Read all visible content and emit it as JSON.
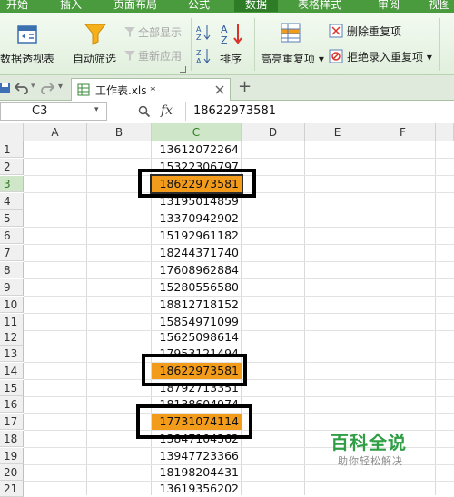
{
  "menu": {
    "tabs": [
      "开始",
      "插入",
      "页面布局",
      "公式",
      "数据",
      "表格样式",
      "审阅",
      "视图"
    ],
    "active": "数据"
  },
  "ribbon": {
    "pivot": "数据透视表",
    "autofilter": "自动筛选",
    "show_all": "全部显示",
    "reapply": "重新应用",
    "sort": "排序",
    "highlight_dup": "高亮重复项",
    "remove_dup": "删除重复项",
    "reject_dup": "拒绝录入重复项"
  },
  "tabbar": {
    "file_tab": "工作表.xls *",
    "add_tab": "+"
  },
  "formula_bar": {
    "name_box": "C3",
    "fx": "fx",
    "value": "18622973581"
  },
  "columns": [
    "A",
    "B",
    "C",
    "D",
    "E",
    "F"
  ],
  "rows": [
    {
      "num": "1",
      "c": "13612072264"
    },
    {
      "num": "2",
      "c": "15322306797"
    },
    {
      "num": "3",
      "c": "18622973581"
    },
    {
      "num": "4",
      "c": "13195014859"
    },
    {
      "num": "5",
      "c": "13370942902"
    },
    {
      "num": "6",
      "c": "15192961182"
    },
    {
      "num": "7",
      "c": "18244371740"
    },
    {
      "num": "8",
      "c": "17608962884"
    },
    {
      "num": "9",
      "c": "15280556580"
    },
    {
      "num": "10",
      "c": "18812718152"
    },
    {
      "num": "11",
      "c": "15854971099"
    },
    {
      "num": "12",
      "c": "15625098614"
    },
    {
      "num": "13",
      "c": "17953121494"
    },
    {
      "num": "14",
      "c": "18622973581"
    },
    {
      "num": "15",
      "c": "18792713351"
    },
    {
      "num": "16",
      "c": "18138604974"
    },
    {
      "num": "17",
      "c": "17731074114"
    },
    {
      "num": "18",
      "c": "13847104362"
    },
    {
      "num": "19",
      "c": "13947723366"
    },
    {
      "num": "20",
      "c": "18198204431"
    },
    {
      "num": "21",
      "c": "13619356202"
    }
  ],
  "watermark": {
    "title": "百科全说",
    "subtitle": "助你轻松解决"
  },
  "colors": {
    "accent": "#4a9a3e",
    "highlight": "#f39c1b"
  }
}
